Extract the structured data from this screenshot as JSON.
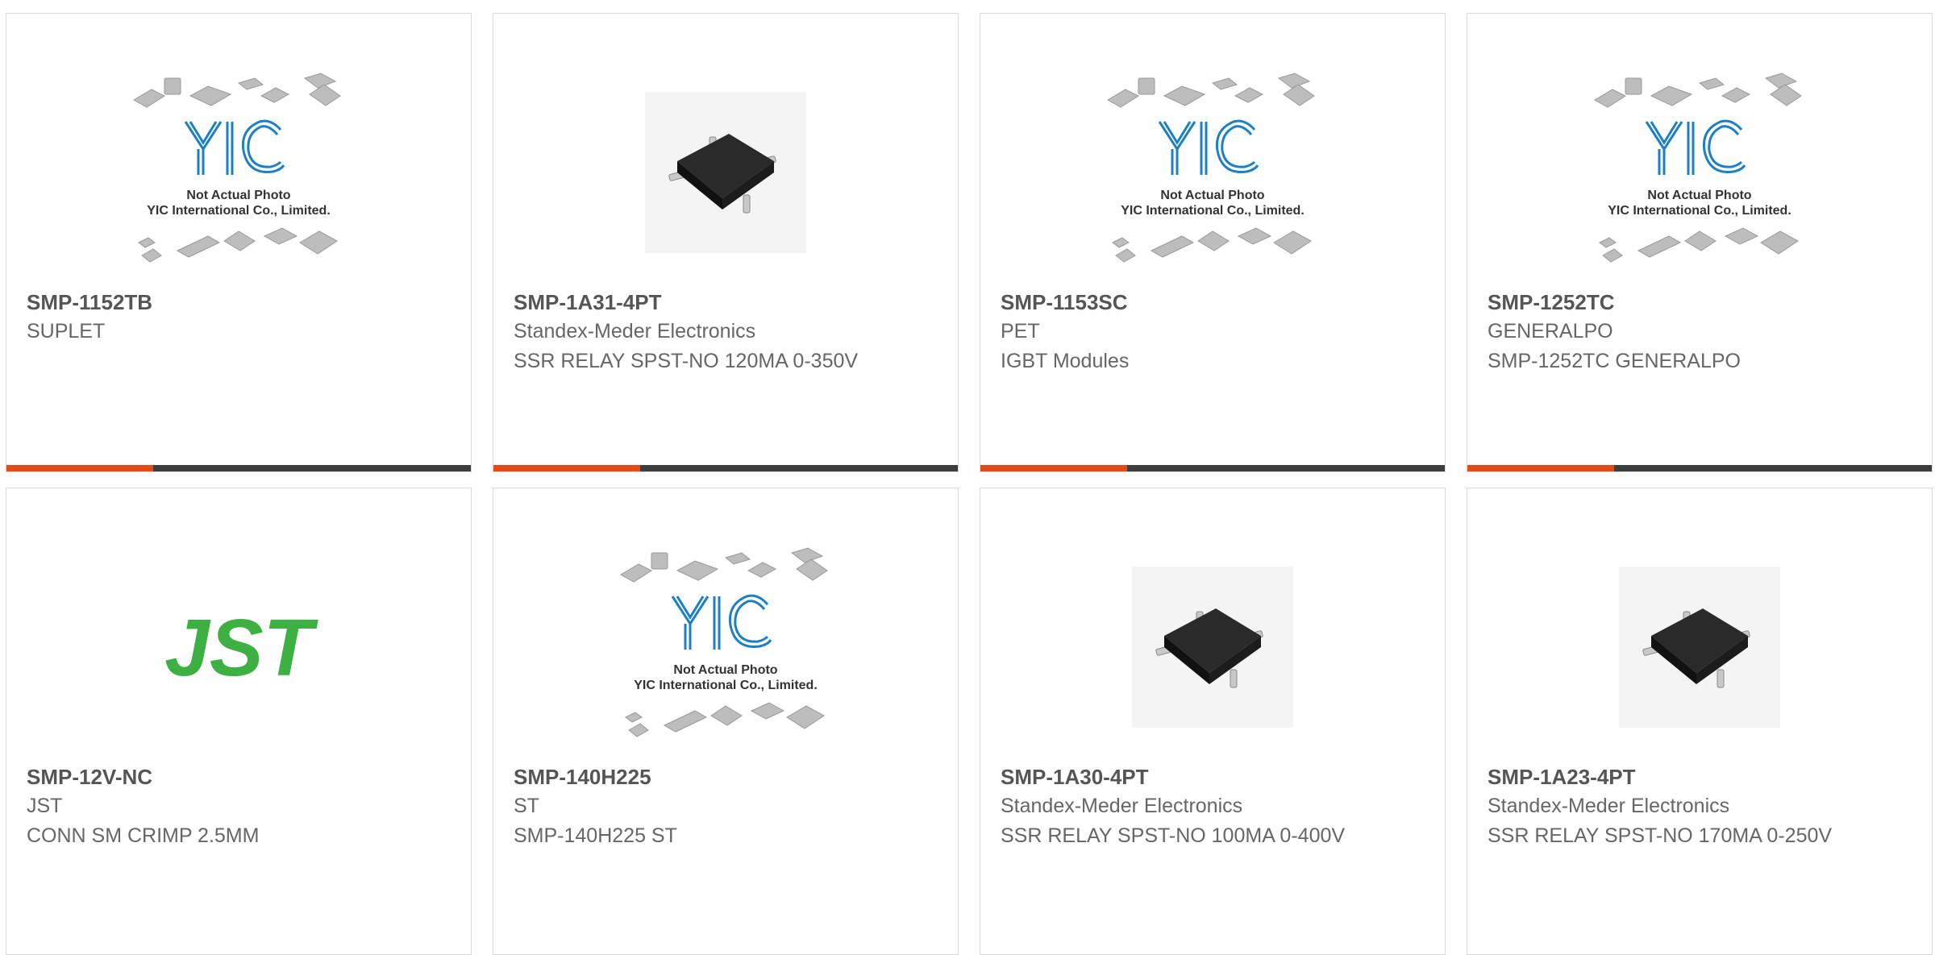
{
  "products": [
    {
      "part": "SMP-1152TB",
      "maker": "SUPLET",
      "desc": "",
      "image": "yic-placeholder",
      "placeholder_line1": "Not Actual Photo",
      "placeholder_line2": "YIC International Co., Limited.",
      "logo_text": "YIC"
    },
    {
      "part": "SMP-1A31-4PT",
      "maker": "Standex-Meder Electronics",
      "desc": "SSR RELAY SPST-NO 120MA 0-350V",
      "image": "smd-relay-photo"
    },
    {
      "part": "SMP-1153SC",
      "maker": "PET",
      "desc": "IGBT Modules",
      "image": "yic-placeholder",
      "placeholder_line1": "Not Actual Photo",
      "placeholder_line2": "YIC International Co., Limited.",
      "logo_text": "YIC"
    },
    {
      "part": "SMP-1252TC",
      "maker": "GENERALPO",
      "desc": "SMP-1252TC GENERALPO",
      "image": "yic-placeholder",
      "placeholder_line1": "Not Actual Photo",
      "placeholder_line2": "YIC International Co., Limited.",
      "logo_text": "YIC"
    },
    {
      "part": "SMP-12V-NC",
      "maker": "JST",
      "desc": "CONN SM CRIMP 2.5MM",
      "image": "jst-logo",
      "logo_text": "JST"
    },
    {
      "part": "SMP-140H225",
      "maker": "ST",
      "desc": "SMP-140H225 ST",
      "image": "yic-placeholder",
      "placeholder_line1": "Not Actual Photo",
      "placeholder_line2": "YIC International Co., Limited.",
      "logo_text": "YIC"
    },
    {
      "part": "SMP-1A30-4PT",
      "maker": "Standex-Meder Electronics",
      "desc": "SSR RELAY SPST-NO 100MA 0-400V",
      "image": "smd-relay-photo"
    },
    {
      "part": "SMP-1A23-4PT",
      "maker": "Standex-Meder Electronics",
      "desc": "SSR RELAY SPST-NO 170MA 0-250V",
      "image": "smd-relay-photo"
    }
  ],
  "colors": {
    "accent_bar": "#e84a17",
    "dark_bar": "#3d3d3d",
    "jst_green": "#3cb040",
    "yic_blue": "#1d7fc4"
  }
}
